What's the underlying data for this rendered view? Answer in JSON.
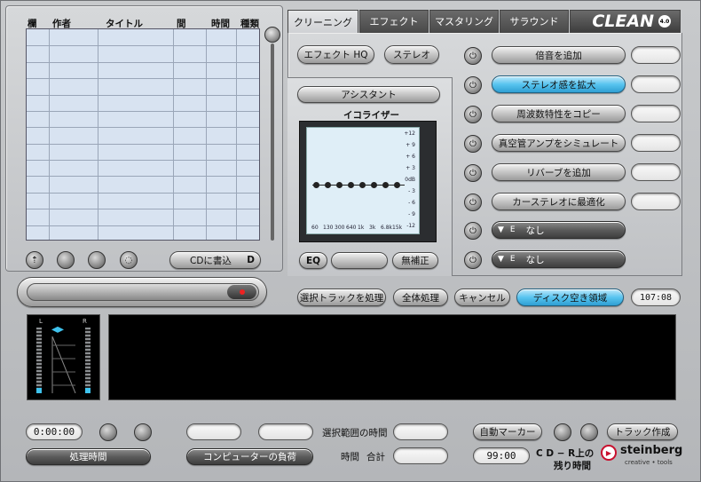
{
  "tabs": [
    "クリーニング",
    "エフェクト",
    "マスタリング",
    "サラウンド"
  ],
  "logo": {
    "text": "CLEAN",
    "version": "4.0"
  },
  "track_table": {
    "headers": [
      "欄",
      "作者",
      "タイトル",
      "間",
      "時間",
      "種類"
    ],
    "rows": 13
  },
  "left_controls": {
    "cd_write_label": "CDに書込",
    "cd_write_suffix": "D"
  },
  "effect_buttons": {
    "effect_hq": "エフェクト HQ",
    "stereo": "ステレオ"
  },
  "assistant": {
    "button": "アシスタント",
    "eq_title": "イコライザー",
    "db_scale": [
      "+12",
      "+ 9",
      "+ 6",
      "+ 3",
      "0dB",
      "- 3",
      "- 6",
      "- 9",
      "-12"
    ],
    "freq_scale": [
      "60",
      "130",
      "300",
      "640",
      "1k",
      "3k",
      "6.8k",
      "15k"
    ],
    "eq_label": "EQ",
    "no_correction": "無補正"
  },
  "actions": [
    {
      "label": "倍音を追加",
      "active": false
    },
    {
      "label": "ステレオ感を拡大",
      "active": true
    },
    {
      "label": "周波数特性をコピー",
      "active": false
    },
    {
      "label": "真空管アンプをシミュレート",
      "active": false
    },
    {
      "label": "リバーブを追加",
      "active": false
    },
    {
      "label": "カーステレオに最適化",
      "active": false
    }
  ],
  "dropdowns": [
    {
      "prefix": "E",
      "value": "なし"
    },
    {
      "prefix": "E",
      "value": "なし"
    }
  ],
  "process": {
    "selected": "選択トラックを処理",
    "all": "全体処理",
    "cancel": "キャンセル",
    "disk": "ディスク空き領域",
    "disk_value": "107:08"
  },
  "meter": {
    "left": "L",
    "right": "R"
  },
  "bottom": {
    "time_value": "0:00:00",
    "process_time": "処理時間",
    "cpu_load": "コンピューターの負荷",
    "selection_time": "選択範囲の時間",
    "time_label": "時間",
    "total_label": "合計",
    "auto_marker": "自動マーカー",
    "track_create": "トラック作成",
    "cdr_value": "99:00",
    "cdr_label_1": "C D − R上の",
    "cdr_label_2": "残り時間"
  },
  "brand": {
    "name": "steinberg",
    "tagline": "creative • tools"
  },
  "colors": {
    "active": "#4cbdea",
    "display": "#000000",
    "eq_bg": "#dfeef7"
  }
}
